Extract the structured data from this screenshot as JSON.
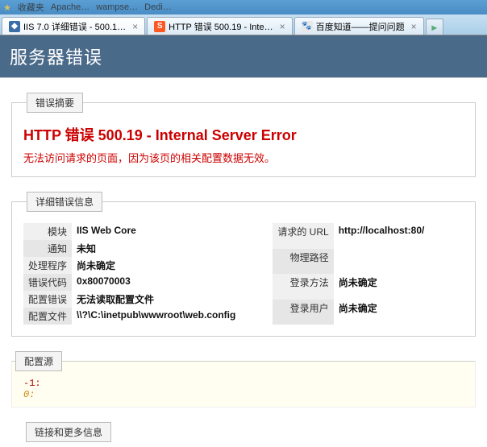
{
  "chrome": {
    "bookmark_items": [
      "收藏夹",
      "Apache…",
      "wampse…",
      "Dedi…"
    ]
  },
  "tabs": [
    {
      "label": "IIS 7.0 详细错误 - 500.1…",
      "active": true,
      "favicon": "IIS"
    },
    {
      "label": "HTTP 错误 500.19 - Inte…",
      "active": false,
      "favicon": "S"
    },
    {
      "label": "百度知道——提问问题",
      "active": false,
      "favicon": "?"
    }
  ],
  "banner": "服务器错误",
  "sections": {
    "summary_legend": "错误摘要",
    "error_title": "HTTP 错误  500.19 - Internal Server Error",
    "error_subtitle": "无法访问请求的页面，因为该页的相关配置数据无效。",
    "details_legend": "详细错误信息",
    "details_left": {
      "module": {
        "k": "模块",
        "v": "IIS Web Core"
      },
      "notify": {
        "k": "通知",
        "v": "未知"
      },
      "handler": {
        "k": "处理程序",
        "v": "尚未确定"
      },
      "errcode": {
        "k": "错误代码",
        "v": "0x80070003"
      },
      "cfgerr": {
        "k": "配置错误",
        "v": "无法读取配置文件"
      },
      "cfgfile": {
        "k": "配置文件",
        "v": "\\\\?\\C:\\inetpub\\wwwroot\\web.config"
      }
    },
    "details_right": {
      "req_url": {
        "k": "请求的 URL",
        "v": "http://localhost:80/"
      },
      "phys": {
        "k": "物理路径",
        "v": ""
      },
      "logon": {
        "k": "登录方法",
        "v": "尚未确定"
      },
      "loguser": {
        "k": "登录用户",
        "v": "尚未确定"
      }
    },
    "config_legend": "配置源",
    "config_lines": {
      "line_no": "-1:",
      "code": "0:"
    },
    "more_legend": "链接和更多信息"
  }
}
